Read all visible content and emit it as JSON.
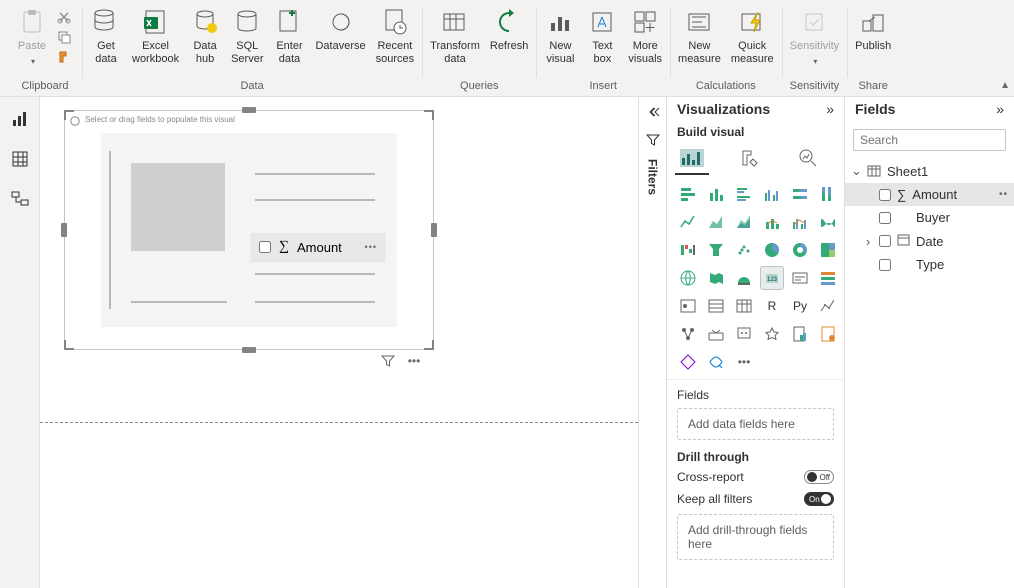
{
  "ribbon": {
    "groups": {
      "clipboard": {
        "label": "Clipboard",
        "paste": "Paste"
      },
      "data": {
        "label": "Data",
        "get_data": "Get\ndata",
        "excel": "Excel\nworkbook",
        "data_hub": "Data\nhub",
        "sql": "SQL\nServer",
        "enter": "Enter\ndata",
        "dataverse": "Dataverse",
        "recent": "Recent\nsources"
      },
      "queries": {
        "label": "Queries",
        "transform": "Transform\ndata",
        "refresh": "Refresh"
      },
      "insert": {
        "label": "Insert",
        "new_visual": "New\nvisual",
        "text_box": "Text\nbox",
        "more": "More\nvisuals"
      },
      "calc": {
        "label": "Calculations",
        "new_measure": "New\nmeasure",
        "quick": "Quick\nmeasure"
      },
      "sensitivity": {
        "label": "Sensitivity",
        "btn": "Sensitivity"
      },
      "share": {
        "label": "Share",
        "publish": "Publish"
      }
    }
  },
  "filters_label": "Filters",
  "visual": {
    "hint": "Select or drag fields to populate this visual",
    "drag_field": "Amount"
  },
  "vis_pane": {
    "title": "Visualizations",
    "build": "Build visual",
    "fields_label": "Fields",
    "fields_well": "Add data fields here",
    "drill_title": "Drill through",
    "cross_report": "Cross-report",
    "cross_report_state": "Off",
    "keep_filters": "Keep all filters",
    "keep_filters_state": "On",
    "drill_well": "Add drill-through fields here"
  },
  "fields_pane": {
    "title": "Fields",
    "search_placeholder": "Search",
    "table": "Sheet1",
    "fields": [
      {
        "name": "Amount",
        "sigma": true,
        "checked": false,
        "selected": true
      },
      {
        "name": "Buyer",
        "sigma": false,
        "checked": false
      },
      {
        "name": "Date",
        "sigma": false,
        "checked": false,
        "expandable": true
      },
      {
        "name": "Type",
        "sigma": false,
        "checked": false
      }
    ]
  }
}
